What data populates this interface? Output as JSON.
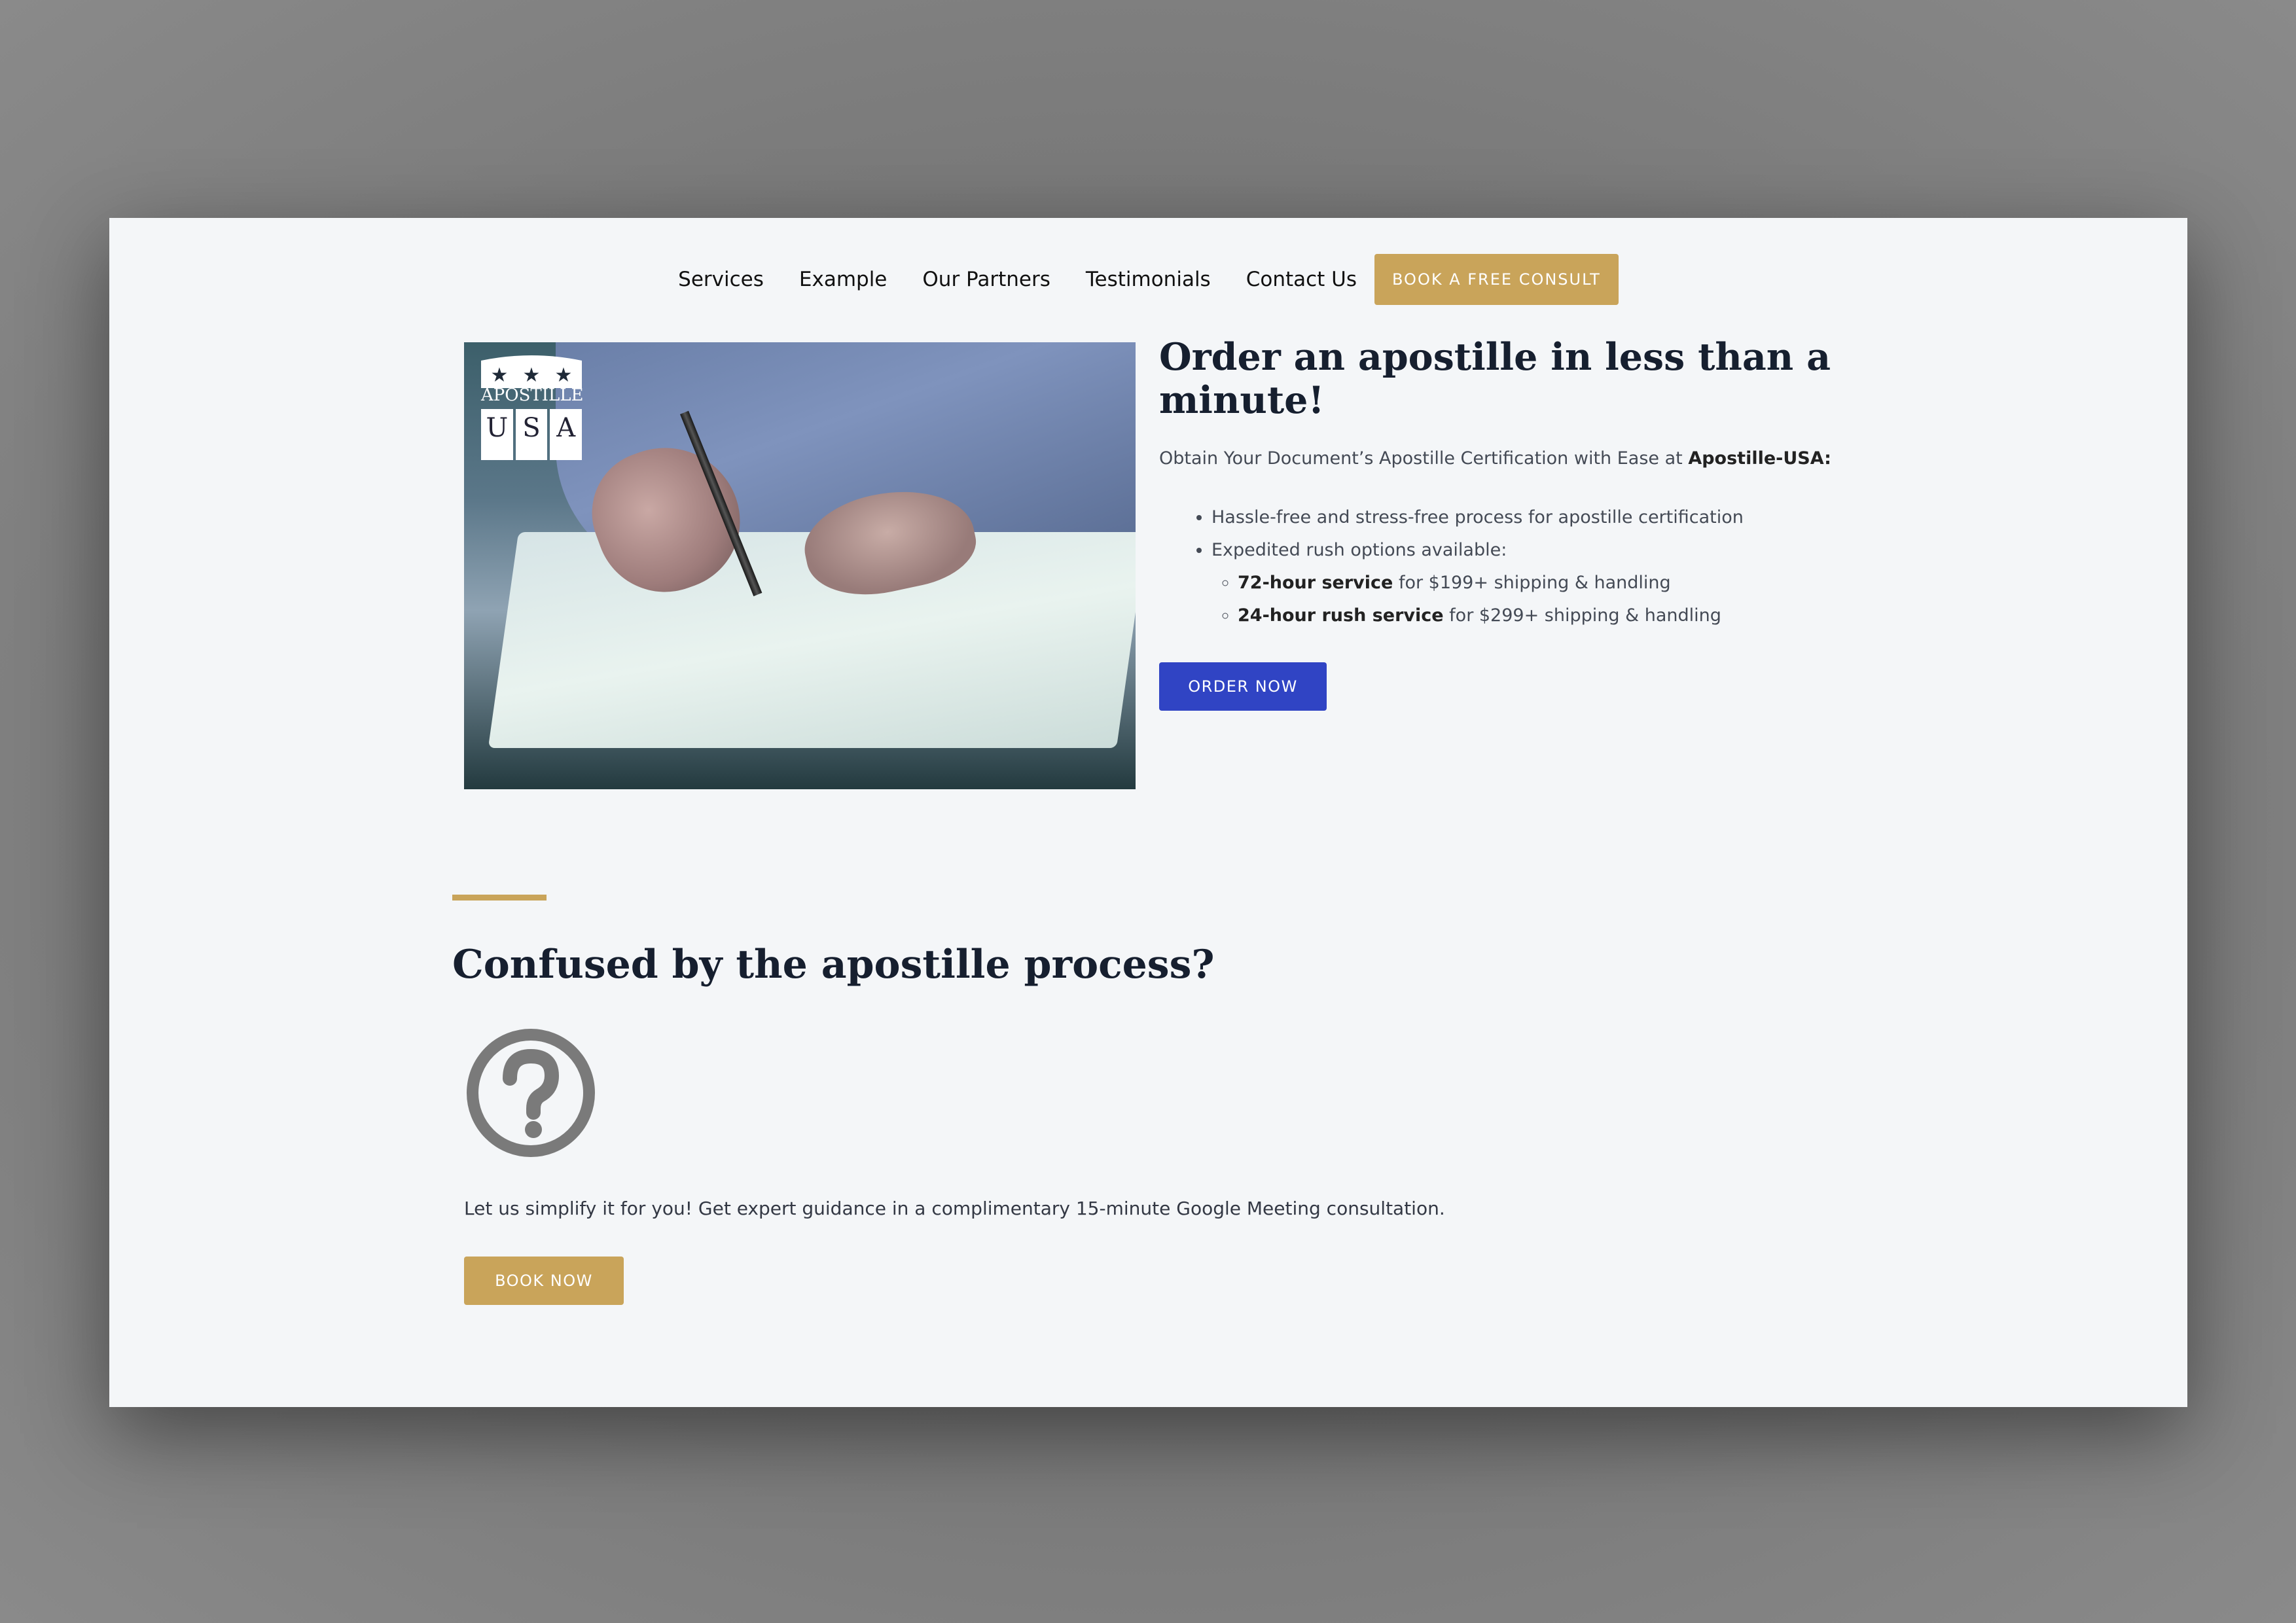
{
  "nav": {
    "links": [
      "Services",
      "Example",
      "Our Partners",
      "Testimonials",
      "Contact Us"
    ],
    "cta": "BOOK A FREE CONSULT"
  },
  "hero": {
    "logo": {
      "line1": "APOSTILLE",
      "letters": [
        "U",
        "S",
        "A"
      ]
    },
    "title": "Order an apostille in less than a minute!",
    "subtitle_prefix": "Obtain Your Document’s Apostille Certification with Ease at ",
    "subtitle_brand": "Apostille-USA:",
    "bullets": [
      "Hassle-free and stress-free process for apostille certification",
      "Expedited rush options available:"
    ],
    "sub_bullets": [
      {
        "bold": "72-hour service",
        "rest": " for $199+ shipping & handling"
      },
      {
        "bold": "24-hour rush service",
        "rest": " for $299+ shipping & handling"
      }
    ],
    "order_button": "ORDER NOW"
  },
  "section2": {
    "title": "Confused by the apostille process?",
    "icon": "question-circle-icon",
    "text": "Let us simplify it for you! Get expert guidance in a complimentary 15-minute Google Meeting consultation.",
    "button": "BOOK NOW"
  },
  "colors": {
    "accent_gold": "#c9a45a",
    "primary_blue": "#3044c4",
    "heading": "#161f2f"
  }
}
